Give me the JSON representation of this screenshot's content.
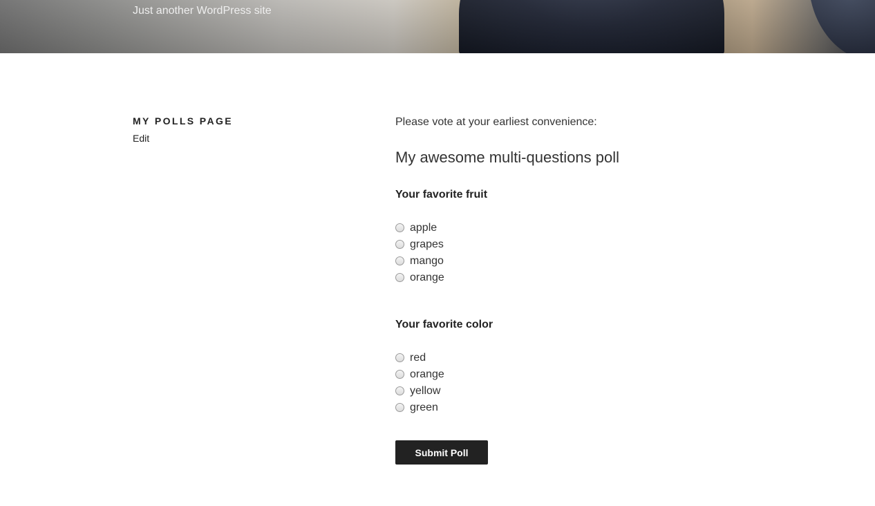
{
  "header": {
    "site_description": "Just another WordPress site"
  },
  "page": {
    "title": "MY POLLS PAGE",
    "edit_label": "Edit"
  },
  "content": {
    "intro": "Please vote at your earliest convenience:",
    "poll_title": "My awesome multi-questions poll",
    "questions": [
      {
        "label": "Your favorite fruit",
        "options": [
          "apple",
          "grapes",
          "mango",
          "orange"
        ]
      },
      {
        "label": "Your favorite color",
        "options": [
          "red",
          "orange",
          "yellow",
          "green"
        ]
      }
    ],
    "submit_label": "Submit Poll"
  }
}
